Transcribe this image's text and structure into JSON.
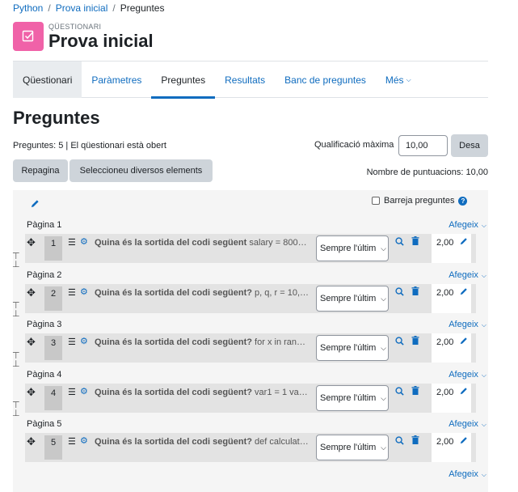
{
  "breadcrumb": [
    "Python",
    "Prova inicial",
    "Preguntes"
  ],
  "module": {
    "label": "QÜESTIONARI",
    "title": "Prova inicial",
    "icon": "quiz-icon",
    "icon_color": "#f062a8"
  },
  "tabs": [
    "Qüestionari",
    "Paràmetres",
    "Preguntes",
    "Resultats",
    "Banc de preguntes",
    "Més"
  ],
  "page": {
    "heading": "Preguntes",
    "status": "Preguntes: 5 | El qüestionari està obert",
    "max_grade_label": "Qualificació màxima",
    "max_grade_value": "10,00",
    "save_label": "Desa",
    "repaginate_label": "Repagina",
    "select_multiple_label": "Seleccioneu diversos elements",
    "total_marks": "Nombre de puntuacions: 10,00",
    "shuffle_label": "Barreja preguntes",
    "add_label": "Afegeix"
  },
  "questions": [
    {
      "page": "Pàgina 1",
      "num": "1",
      "title": "Quina és la sortida del codi següent",
      "snippet": " salary = 800…",
      "select": "Sempre l'últim",
      "mark": "2,00"
    },
    {
      "page": "Pàgina 2",
      "num": "2",
      "title": "Quina és la sortida del codi següent?",
      "snippet": " p, q, r = 10,…",
      "select": "Sempre l'últim",
      "mark": "2,00"
    },
    {
      "page": "Pàgina 3",
      "num": "3",
      "title": "Quina és la sortida del codi següent?",
      "snippet": " for x in ran…",
      "select": "Sempre l'últim",
      "mark": "2,00"
    },
    {
      "page": "Pàgina 4",
      "num": "4",
      "title": "Quina és la sortida del codi següent?",
      "snippet": " var1 = 1 va…",
      "select": "Sempre l'últim",
      "mark": "2,00"
    },
    {
      "page": "Pàgina 5",
      "num": "5",
      "title": "Quina és la sortida del codi següent?",
      "snippet": " def calculat…",
      "select": "Sempre l'últim",
      "mark": "2,00"
    }
  ]
}
